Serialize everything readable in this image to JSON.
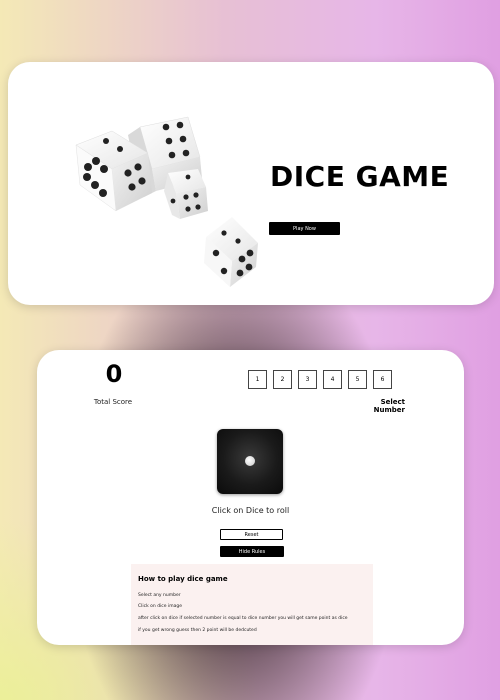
{
  "hero": {
    "title": "DICE GAME",
    "play_label": "Play Now"
  },
  "game": {
    "total_score": "0",
    "total_score_label": "Total Score",
    "numbers": [
      "1",
      "2",
      "3",
      "4",
      "5",
      "6"
    ],
    "select_label": "Select Number",
    "current_die_value": 1,
    "click_label": "Click on Dice to roll",
    "reset_label": "Reset",
    "hide_rules_label": "Hide Rules"
  },
  "rules": {
    "title": "How to play dice game",
    "lines": [
      "Select any number",
      "Click on dice image",
      "after click on dice if selected number is equal to dice number you will get same point as dice",
      "if you get wrong guess then 2 point will be dedcuted"
    ]
  }
}
